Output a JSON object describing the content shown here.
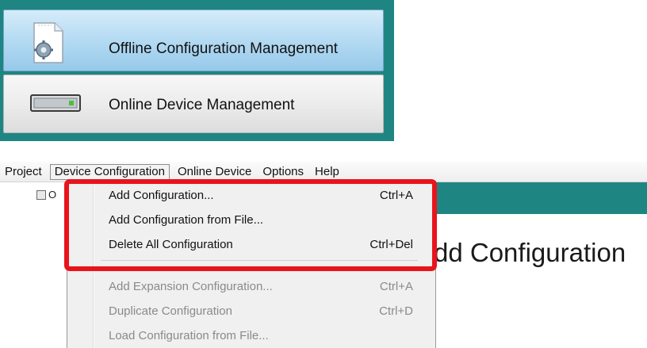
{
  "nav": {
    "offline_label": "Offline Configuration Management",
    "online_label": "Online Device Management",
    "offline_icon": "config-document-gear-icon",
    "online_icon": "device-hardware-icon"
  },
  "menubar": {
    "items": [
      "Project",
      "Device Configuration",
      "Online Device",
      "Options",
      "Help"
    ]
  },
  "tree": {
    "item_text": "O"
  },
  "heading": "dd Configuration",
  "dropdown": {
    "items": [
      {
        "label": "Add Configuration...",
        "shortcut": "Ctrl+A"
      },
      {
        "label": "Add Configuration from File...",
        "shortcut": ""
      },
      {
        "label": "Delete All Configuration",
        "shortcut": "Ctrl+Del"
      },
      {
        "label": "Add Expansion Configuration...",
        "shortcut": "Ctrl+A"
      },
      {
        "label": "Duplicate Configuration",
        "shortcut": "Ctrl+D"
      },
      {
        "label": "Load Configuration from File...",
        "shortcut": ""
      }
    ]
  },
  "colors": {
    "teal": "#1f8582",
    "highlight_red": "#e8141c",
    "disabled_text": "#8a8a8a"
  }
}
